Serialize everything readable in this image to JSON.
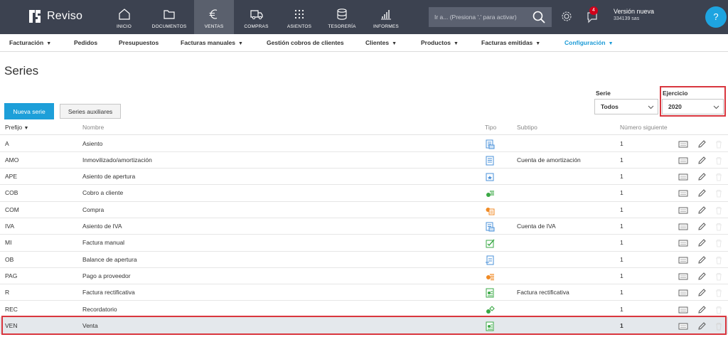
{
  "brand": {
    "name": "Reviso",
    "accent": "#1d9fd9"
  },
  "topnav": [
    {
      "label": "INICIO",
      "icon": "home-icon",
      "active": false
    },
    {
      "label": "DOCUMENTOS",
      "icon": "folder-icon",
      "active": false
    },
    {
      "label": "VENTAS",
      "icon": "euro-icon",
      "active": true
    },
    {
      "label": "COMPRAS",
      "icon": "truck-icon",
      "active": false
    },
    {
      "label": "ASIENTOS",
      "icon": "grid-dots-icon",
      "active": false
    },
    {
      "label": "TESORERÍA",
      "icon": "database-icon",
      "active": false
    },
    {
      "label": "INFORMES",
      "icon": "bar-chart-icon",
      "active": false
    }
  ],
  "search": {
    "placeholder": "Ir a... (Presiona '.' para activar)"
  },
  "notifications": {
    "count": "4"
  },
  "account": {
    "title": "Versión nueva",
    "subtitle": "334139 sas"
  },
  "help": {
    "label": "?"
  },
  "subnav": [
    {
      "label": "Facturación",
      "dropdown": true,
      "active": false
    },
    {
      "label": "Pedidos",
      "dropdown": false,
      "active": false
    },
    {
      "label": "Presupuestos",
      "dropdown": false,
      "active": false
    },
    {
      "label": "Facturas manuales",
      "dropdown": true,
      "active": false
    },
    {
      "label": "Gestión cobros de clientes",
      "dropdown": false,
      "active": false
    },
    {
      "label": "Clientes",
      "dropdown": true,
      "active": false
    },
    {
      "label": "Productos",
      "dropdown": true,
      "active": false
    },
    {
      "label": "Facturas emitidas",
      "dropdown": true,
      "active": false
    },
    {
      "label": "Configuración",
      "dropdown": true,
      "active": true
    }
  ],
  "page": {
    "title": "Series"
  },
  "toolbar": {
    "new_label": "Nueva serie",
    "aux_label": "Series auxiliares"
  },
  "filters": {
    "serie": {
      "label": "Serie",
      "value": "Todos"
    },
    "ejercicio": {
      "label": "Ejercicio",
      "value": "2020"
    }
  },
  "table": {
    "headers": {
      "prefix": "Prefijo",
      "name": "Nombre",
      "type": "Tipo",
      "subtype": "Subtipo",
      "next": "Número siguiente"
    },
    "rows": [
      {
        "prefix": "A",
        "name": "Asiento",
        "type_icon": "journal-entry-icon",
        "subtype": "",
        "next": "1",
        "deletable": false,
        "selected": false
      },
      {
        "prefix": "AMO",
        "name": "Inmovilizado/amortización",
        "type_icon": "depreciation-icon",
        "subtype": "Cuenta de amortización",
        "next": "1",
        "deletable": false,
        "selected": false
      },
      {
        "prefix": "APE",
        "name": "Asiento de apertura",
        "type_icon": "opening-entry-icon",
        "subtype": "",
        "next": "1",
        "deletable": false,
        "selected": false
      },
      {
        "prefix": "COB",
        "name": "Cobro a cliente",
        "type_icon": "customer-payment-icon",
        "subtype": "",
        "next": "1",
        "deletable": false,
        "selected": false
      },
      {
        "prefix": "COM",
        "name": "Compra",
        "type_icon": "purchase-icon",
        "subtype": "",
        "next": "1",
        "deletable": false,
        "selected": false
      },
      {
        "prefix": "IVA",
        "name": "Asiento de IVA",
        "type_icon": "vat-entry-icon",
        "subtype": "Cuenta de IVA",
        "next": "1",
        "deletable": false,
        "selected": false
      },
      {
        "prefix": "MI",
        "name": "Factura manual",
        "type_icon": "manual-invoice-icon",
        "subtype": "",
        "next": "1",
        "deletable": false,
        "selected": false
      },
      {
        "prefix": "OB",
        "name": "Balance de apertura",
        "type_icon": "opening-balance-icon",
        "subtype": "",
        "next": "1",
        "deletable": false,
        "selected": false
      },
      {
        "prefix": "PAG",
        "name": "Pago a proveedor",
        "type_icon": "supplier-payment-icon",
        "subtype": "",
        "next": "1",
        "deletable": false,
        "selected": false
      },
      {
        "prefix": "R",
        "name": "Factura rectificativa",
        "type_icon": "credit-note-icon",
        "subtype": "Factura rectificativa",
        "next": "1",
        "deletable": false,
        "selected": false
      },
      {
        "prefix": "REC",
        "name": "Recordatorio",
        "type_icon": "reminder-icon",
        "subtype": "",
        "next": "1",
        "deletable": false,
        "selected": false
      },
      {
        "prefix": "VEN",
        "name": "Venta",
        "type_icon": "sales-invoice-icon",
        "subtype": "",
        "next": "1",
        "deletable": true,
        "selected": true
      }
    ]
  }
}
